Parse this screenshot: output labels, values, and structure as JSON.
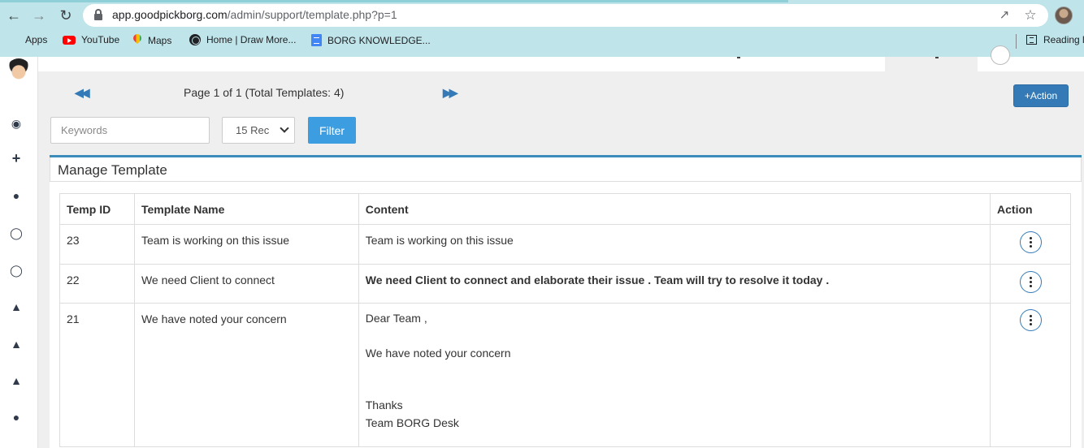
{
  "browser": {
    "url_host": "app.goodpickborg.com",
    "url_path": "/admin/support/template.php?p=1",
    "bookmarks": [
      {
        "label": "Apps",
        "icon": "apps-grid-icon"
      },
      {
        "label": "YouTube",
        "icon": "youtube-icon"
      },
      {
        "label": "Maps",
        "icon": "maps-icon"
      },
      {
        "label": "Home | Draw More...",
        "icon": "globe-icon"
      },
      {
        "label": "BORG KNOWLEDGE...",
        "icon": "docs-icon"
      }
    ],
    "reading_list_label": "Reading l"
  },
  "sidebar": {
    "icons": [
      "dashboard-icon",
      "plus-icon",
      "user-icon",
      "chat-icon",
      "chat-icon",
      "thumbs-up-icon",
      "thumbs-up-icon",
      "thumbs-up-icon",
      "user-icon"
    ]
  },
  "toolbar": {
    "pager_text": "Page 1 of 1 (Total Templates: 4)",
    "action_label": "Action",
    "keywords_placeholder": "Keywords",
    "records_selected": "15 Rec",
    "filter_label": "Filter"
  },
  "panel": {
    "title": "Manage Template",
    "columns": [
      "Temp ID",
      "Template Name",
      "Content",
      "Action"
    ],
    "rows": [
      {
        "id": "23",
        "name": "Team is working on this issue",
        "content": "Team is working on this issue"
      },
      {
        "id": "22",
        "name": "We need Client to connect",
        "content": "We need Client  to connect and elaborate their issue .  Team will try to resolve it today ."
      },
      {
        "id": "21",
        "name": "We have noted your concern",
        "content_lines": [
          "Dear Team ,",
          "We have noted your concern",
          "Thanks",
          "Team BORG Desk"
        ]
      }
    ]
  },
  "colors": {
    "browser_bar": "#bfe4ea",
    "primary": "#337ab7",
    "filter": "#3c9ee0",
    "panel_accent": "#3c8dbc"
  }
}
